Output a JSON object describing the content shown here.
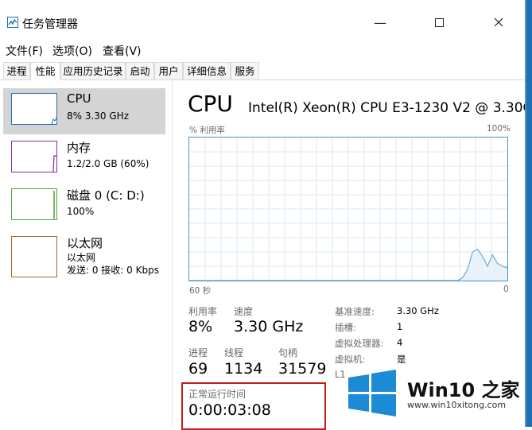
{
  "window": {
    "title": "任务管理器"
  },
  "menu": [
    "文件(F)",
    "选项(O)",
    "查看(V)"
  ],
  "tabs": [
    "进程",
    "性能",
    "应用历史记录",
    "启动",
    "用户",
    "详细信息",
    "服务"
  ],
  "active_tab": 1,
  "resources": [
    {
      "name": "CPU",
      "line1": "8% 3.30 GHz",
      "line2": "",
      "color": "#1d6fb5"
    },
    {
      "name": "内存",
      "line1": "1.2/2.0 GB (60%)",
      "line2": "",
      "color": "#8b2aa6"
    },
    {
      "name": "磁盘 0 (C: D:)",
      "line1": "100%",
      "line2": "",
      "color": "#4aa338"
    },
    {
      "name": "以太网",
      "line1": "以太网",
      "line2": "发送: 0 接收: 0 Kbps",
      "color": "#a5652a"
    }
  ],
  "detail": {
    "title": "CPU",
    "model": "Intel(R) Xeon(R) CPU E3-1230 V2 @ 3.30G...",
    "y_label": "% 利用率",
    "y_max": "100%",
    "x_left": "60 秒",
    "x_right": "0",
    "stats": {
      "utilization_label": "利用率",
      "utilization": "8%",
      "speed_label": "速度",
      "speed": "3.30 GHz",
      "processes_label": "进程",
      "processes": "69",
      "threads_label": "线程",
      "threads": "1134",
      "handles_label": "句柄",
      "handles": "31579",
      "uptime_label": "正常运行时间",
      "uptime": "0:00:03:08"
    },
    "kv": [
      {
        "k": "基准速度:",
        "v": "3.30 GHz"
      },
      {
        "k": "插槽:",
        "v": "1"
      },
      {
        "k": "虚拟处理器:",
        "v": "4"
      },
      {
        "k": "虚拟机:",
        "v": "是"
      },
      {
        "k": "L1",
        "v": ""
      }
    ]
  },
  "chart_data": {
    "type": "area",
    "x_range_seconds": [
      60,
      0
    ],
    "ylim": [
      0,
      100
    ],
    "utilization": [
      0,
      0,
      0,
      0,
      0,
      0,
      0,
      0,
      0,
      0,
      0,
      0,
      0,
      0,
      0,
      0,
      0,
      0,
      0,
      0,
      0,
      0,
      0,
      0,
      0,
      0,
      0,
      0,
      0,
      0,
      0,
      0,
      0,
      0,
      0,
      0,
      0,
      0,
      0,
      0,
      0,
      0,
      0,
      0,
      0,
      0,
      0,
      0,
      0,
      0,
      0,
      0,
      0,
      0,
      0,
      2,
      8,
      20,
      22,
      17,
      10,
      18,
      12,
      10,
      9
    ]
  },
  "watermark": {
    "brand": "Win10 之家",
    "url": "www.win10xitong.com"
  },
  "colors": {
    "graph_line": "#6aa8d8",
    "graph_fill": "#e8f2fa",
    "grid": "#d9e8f4",
    "border": "#4a90c8"
  }
}
